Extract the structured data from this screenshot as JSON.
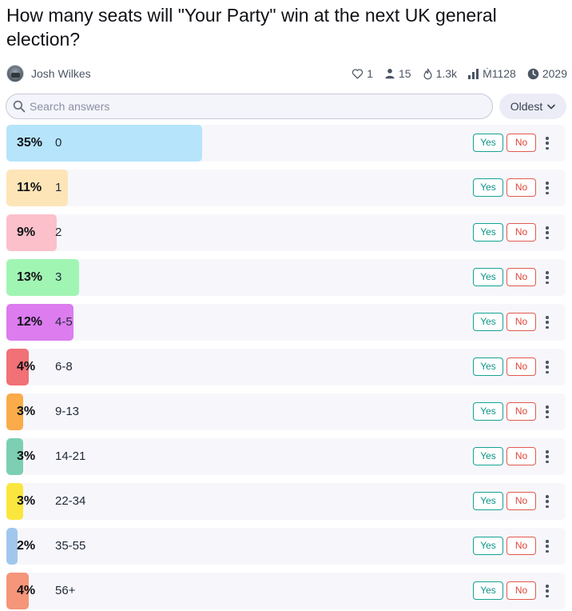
{
  "question": {
    "title": "How many seats will \"Your Party\" win at the next UK general election?"
  },
  "author": {
    "name": "Josh Wilkes"
  },
  "stats": {
    "likes": "1",
    "traders": "15",
    "views": "1.3k",
    "volume": "Ṁ1128",
    "close_year": "2029"
  },
  "search": {
    "placeholder": "Search answers",
    "value": ""
  },
  "sort": {
    "label": "Oldest"
  },
  "buttons": {
    "yes": "Yes",
    "no": "No"
  },
  "answers": [
    {
      "pct": "35%",
      "label": "0",
      "prob": 0.35,
      "color": "#b6e4fb"
    },
    {
      "pct": "11%",
      "label": "1",
      "prob": 0.11,
      "color": "#fde5b8"
    },
    {
      "pct": "9%",
      "label": "2",
      "prob": 0.09,
      "color": "#fbc0ca"
    },
    {
      "pct": "13%",
      "label": "3",
      "prob": 0.13,
      "color": "#a1f5b3"
    },
    {
      "pct": "12%",
      "label": "4-5",
      "prob": 0.12,
      "color": "#dc7cef"
    },
    {
      "pct": "4%",
      "label": "6-8",
      "prob": 0.04,
      "color": "#f07176"
    },
    {
      "pct": "3%",
      "label": "9-13",
      "prob": 0.03,
      "color": "#fbab49"
    },
    {
      "pct": "3%",
      "label": "14-21",
      "prob": 0.03,
      "color": "#7ccfb2"
    },
    {
      "pct": "3%",
      "label": "22-34",
      "prob": 0.03,
      "color": "#fbe63d"
    },
    {
      "pct": "2%",
      "label": "35-55",
      "prob": 0.02,
      "color": "#a1c7ed"
    },
    {
      "pct": "4%",
      "label": "56+",
      "prob": 0.04,
      "color": "#f5957a"
    }
  ]
}
